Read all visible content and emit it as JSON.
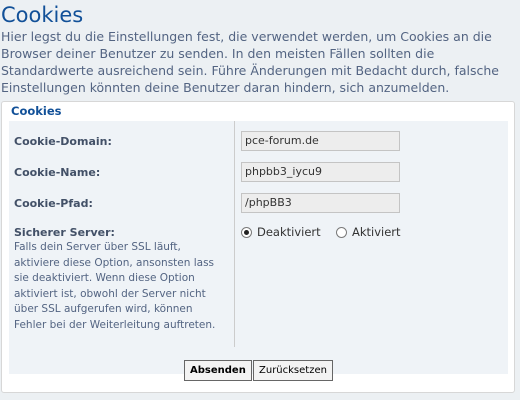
{
  "page": {
    "title": "Cookies",
    "intro": "Hier legst du die Einstellungen fest, die verwendet werden, um Cookies an die Browser deiner Benutzer zu senden. In den meisten Fällen sollten die Standardwerte ausreichend sein. Führe Änderungen mit Bedacht durch, falsche Einstellungen könnten deine Benutzer daran hindern, sich anzumelden."
  },
  "fieldset": {
    "legend": "Cookies",
    "cookie_domain": {
      "label": "Cookie-Domain:",
      "value": "pce-forum.de"
    },
    "cookie_name": {
      "label": "Cookie-Name:",
      "value": "phpbb3_iycu9"
    },
    "cookie_path": {
      "label": "Cookie-Pfad:",
      "value": "/phpBB3"
    },
    "secure": {
      "label": "Sicherer Server:",
      "explain": "Falls dein Server über SSL läuft, aktiviere diese Option, ansonsten lass sie deaktiviert. Wenn diese Option aktiviert ist, obwohl der Server nicht über SSL aufgerufen wird, können Fehler bei der Weiterleitung auftreten.",
      "options": [
        {
          "label": "Deaktiviert",
          "checked": true
        },
        {
          "label": "Aktiviert",
          "checked": false
        }
      ]
    }
  },
  "buttons": {
    "submit": "Absenden",
    "reset": "Zurücksetzen"
  },
  "colors": {
    "title": "#115098",
    "text": "#536482",
    "background": "#ecf0f3",
    "panel": "#ffffff",
    "inner_panel": "#eff3f7"
  }
}
